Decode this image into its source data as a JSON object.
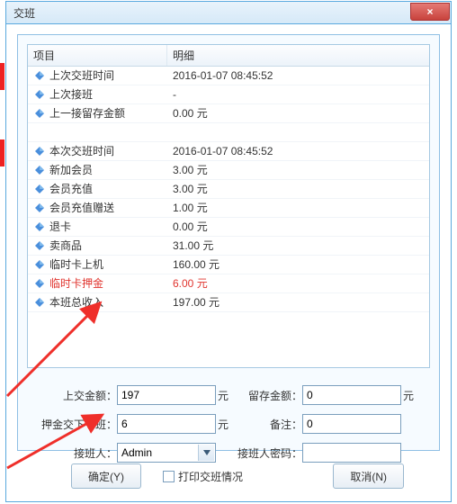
{
  "window": {
    "title": "交班",
    "close_aria": "关闭"
  },
  "grid": {
    "headers": {
      "col1": "项目",
      "col2": "明细"
    },
    "rows": [
      {
        "label": "上次交班时间",
        "value": "2016-01-07 08:45:52",
        "highlight": false
      },
      {
        "label": "上次接班",
        "value": "-",
        "highlight": false
      },
      {
        "label": "上一接留存金额",
        "value": "0.00 元",
        "highlight": false
      },
      {
        "label": "",
        "value": "",
        "highlight": false,
        "blank": true
      },
      {
        "label": "本次交班时间",
        "value": "2016-01-07 08:45:52",
        "highlight": false
      },
      {
        "label": "新加会员",
        "value": "3.00 元",
        "highlight": false
      },
      {
        "label": "会员充值",
        "value": "3.00 元",
        "highlight": false
      },
      {
        "label": "会员充值赠送",
        "value": "1.00 元",
        "highlight": false
      },
      {
        "label": "退卡",
        "value": "0.00 元",
        "highlight": false
      },
      {
        "label": "卖商品",
        "value": "31.00 元",
        "highlight": false
      },
      {
        "label": "临时卡上机",
        "value": "160.00 元",
        "highlight": false
      },
      {
        "label": "临时卡押金",
        "value": "6.00 元",
        "highlight": true
      },
      {
        "label": "本班总收入",
        "value": "197.00 元",
        "highlight": false
      }
    ]
  },
  "form": {
    "hand_over_amount": {
      "label": "上交金额：",
      "value": "197",
      "unit": "元"
    },
    "retain_amount": {
      "label": "留存金额：",
      "value": "0",
      "unit": "元"
    },
    "deposit_next": {
      "label": "押金交下一班：",
      "value": "6",
      "unit": "元"
    },
    "remark": {
      "label": "备注：",
      "value": "0"
    },
    "successor": {
      "label": "接班人：",
      "value": "Admin"
    },
    "successor_pwd": {
      "label": "接班人密码：",
      "value": ""
    }
  },
  "buttons": {
    "ok": "确定(Y)",
    "print": "打印交班情况",
    "cancel": "取消(N)"
  },
  "icons": {
    "diamond_color": "#2a7bd6",
    "close_glyph": "×"
  }
}
